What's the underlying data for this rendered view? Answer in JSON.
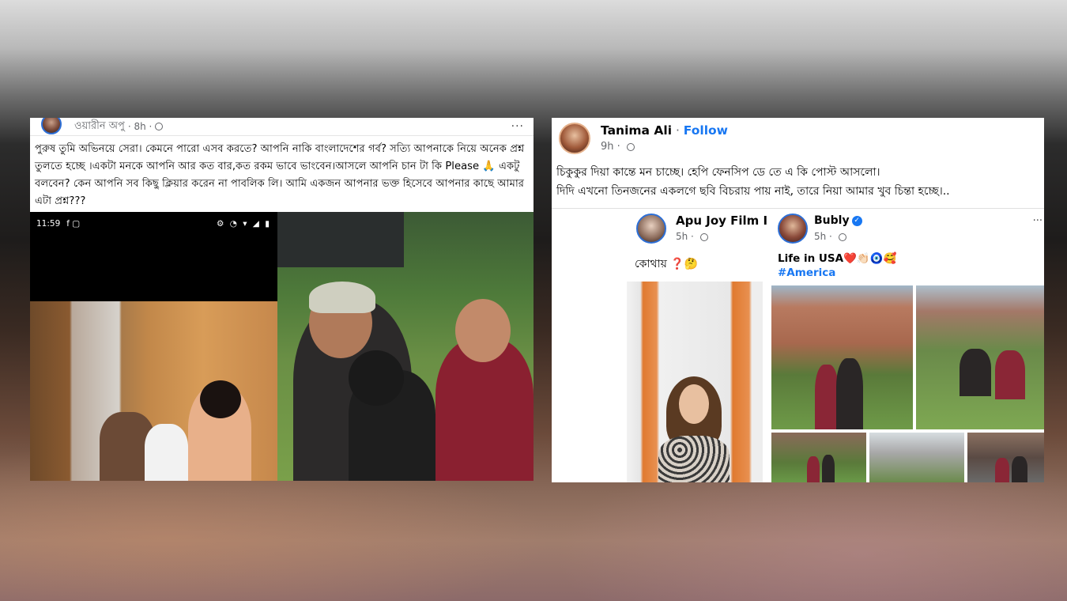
{
  "left_post": {
    "author": "ওয়ারীন অপু",
    "time": "· 8h ·",
    "text": "পুরুষ তুমি অভিনয়ে সেরা। কেমনে পারো এসব করতে? আপনি নাকি বাংলাদেশের গর্ব? সত্যি আপনাকে নিয়ে অনেক প্রশ্ন তুলতে হচ্ছে ।একটা মনকে আপনি আর কত বার,কত রকম ভাবে ভাংবেন।আসলে আপনি চান টা কি Please 🙏 একটু বলবেন? কেন আপনি সব কিছু ক্লিয়ার করেন না পাবলিক লি। আমি একজন আপনার ভক্ত হিসেবে আপনার কাছে আমার এটা প্রশ্ন???",
    "phone_status": {
      "time": "11:59",
      "left_icons": "f ▢",
      "right_icons": "⚙ ◔ ▾ ◢ ▮"
    }
  },
  "right_post": {
    "author": "Tanima Ali",
    "separator": " · ",
    "follow": "Follow",
    "time": "9h · ",
    "line1": "চিকুকুর দিয়া কান্তে মন চাচ্ছে। হেপি ফেনসিপ ডে তে এ কি পোস্ট আসলো।",
    "line2": "দিদি এখনো তিনজনের একলগে ছবি বিচরায় পায় নাই, তারে নিয়া আমার খুব চিন্তা হচ্ছে।..",
    "shared_left": {
      "author": "Apu Joy Film I",
      "time": "5h · ",
      "caption": "কোথায় ❓🤔"
    },
    "shared_right": {
      "author": "Bubly",
      "verified": "✓",
      "time": "5h · ",
      "more": "···",
      "caption": "Life in USA❤️👏🏻🧿🥰",
      "hashtag": "#America"
    }
  },
  "icons": {
    "globe": "globe-icon",
    "more": "more-options-icon",
    "verified": "verified-badge-icon"
  },
  "colors": {
    "facebook_blue": "#1877f2",
    "meta_gray": "#65676b",
    "text": "#050505"
  }
}
